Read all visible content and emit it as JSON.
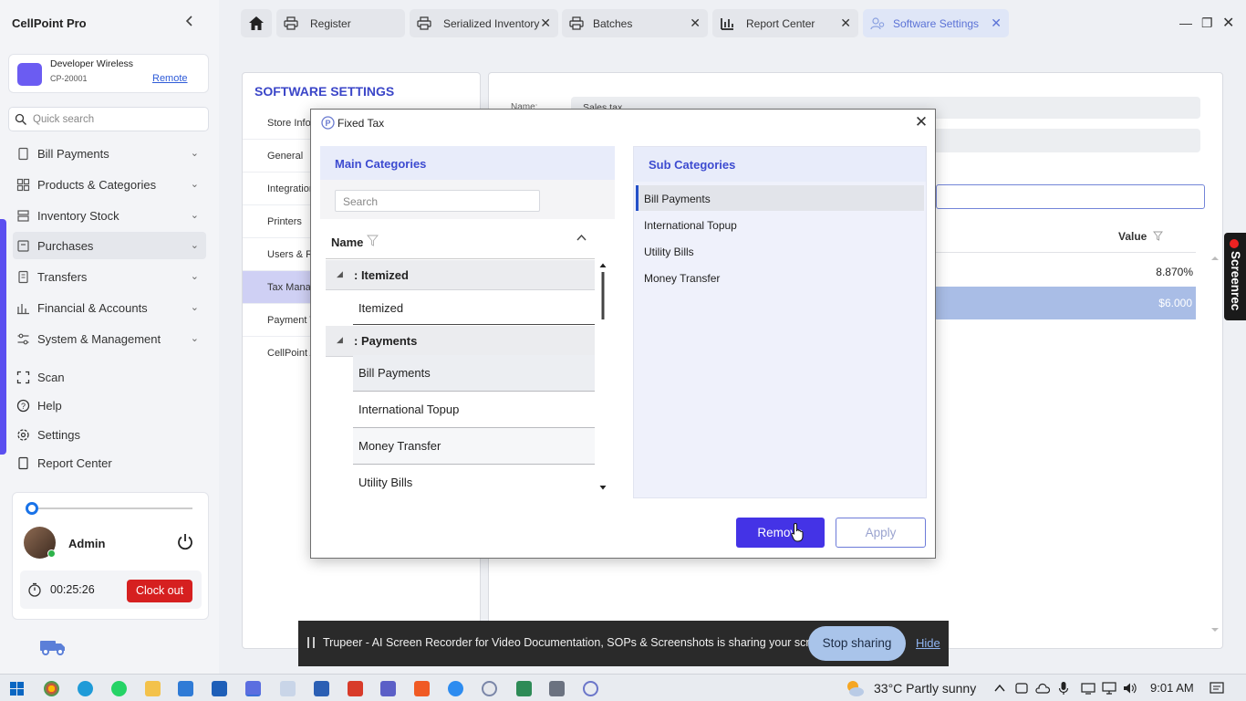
{
  "app": {
    "title": "CellPoint Pro",
    "collapse_icon": "chevron-left-icon"
  },
  "store": {
    "name": "Developer Wireless",
    "id": "CP-20001",
    "mode_link": "Remote"
  },
  "quick_search": {
    "placeholder": "Quick search"
  },
  "nav": [
    {
      "label": "Bill Payments",
      "icon": "receipt-icon"
    },
    {
      "label": "Products & Categories",
      "icon": "grid-icon"
    },
    {
      "label": "Inventory Stock",
      "icon": "stack-icon"
    },
    {
      "label": "Purchases",
      "icon": "cart-icon",
      "active": true
    },
    {
      "label": "Transfers",
      "icon": "transfer-icon"
    },
    {
      "label": "Financial & Accounts",
      "icon": "finance-icon"
    },
    {
      "label": "System & Management",
      "icon": "sliders-icon"
    }
  ],
  "nav_extra": [
    {
      "label": "Scan",
      "icon": "scan-icon"
    },
    {
      "label": "Help",
      "icon": "help-icon"
    },
    {
      "label": "Settings",
      "icon": "gear-icon"
    },
    {
      "label": "Report Center",
      "icon": "report-icon"
    }
  ],
  "profile": {
    "name": "Admin",
    "timer": "00:25:26",
    "clock_out_label": "Clock out"
  },
  "tabs": [
    {
      "label": "Register",
      "icon": "printer-icon"
    },
    {
      "label": "Serialized Inventory",
      "icon": "printer-icon"
    },
    {
      "label": "Batches",
      "icon": "printer-icon"
    },
    {
      "label": "Report Center",
      "icon": "bar-chart-icon"
    },
    {
      "label": "Software Settings",
      "icon": "settings-people-icon",
      "active": true
    }
  ],
  "settings": {
    "title": "SOFTWARE SETTINGS",
    "items": [
      "Store Info",
      "General",
      "Integration",
      "Printers",
      "Users & R",
      "Tax Manag",
      "Payment T",
      "CellPoint A"
    ],
    "active_index": 5
  },
  "background": {
    "name_label": "Name:",
    "name_value": "Sales tax",
    "value_header": "Value",
    "row_values": [
      "8.870%",
      "$6.000"
    ]
  },
  "dialog": {
    "title": "Fixed Tax",
    "main_header": "Main Categories",
    "search_placeholder": "Search",
    "column_name": "Name",
    "groups": [
      {
        "label": ": Itemized",
        "items": [
          "Itemized"
        ]
      },
      {
        "label": ": Payments",
        "items": [
          "Bill Payments",
          "International Topup",
          "Money Transfer",
          "Utility Bills"
        ]
      }
    ],
    "sub_header": "Sub Categories",
    "sub_items": [
      "Bill Payments",
      "International Topup",
      "Utility Bills",
      "Money Transfer"
    ],
    "remove_label": "Remove",
    "apply_label": "Apply"
  },
  "screenrec": {
    "label": "Screenrec"
  },
  "share_bar": {
    "text": "Trupeer - AI Screen Recorder for Video Documentation, SOPs & Screenshots is sharing your screen.",
    "stop_label": "Stop sharing",
    "hide_label": "Hide"
  },
  "taskbar": {
    "weather": "33°C  Partly sunny",
    "time": "9:01 AM"
  }
}
